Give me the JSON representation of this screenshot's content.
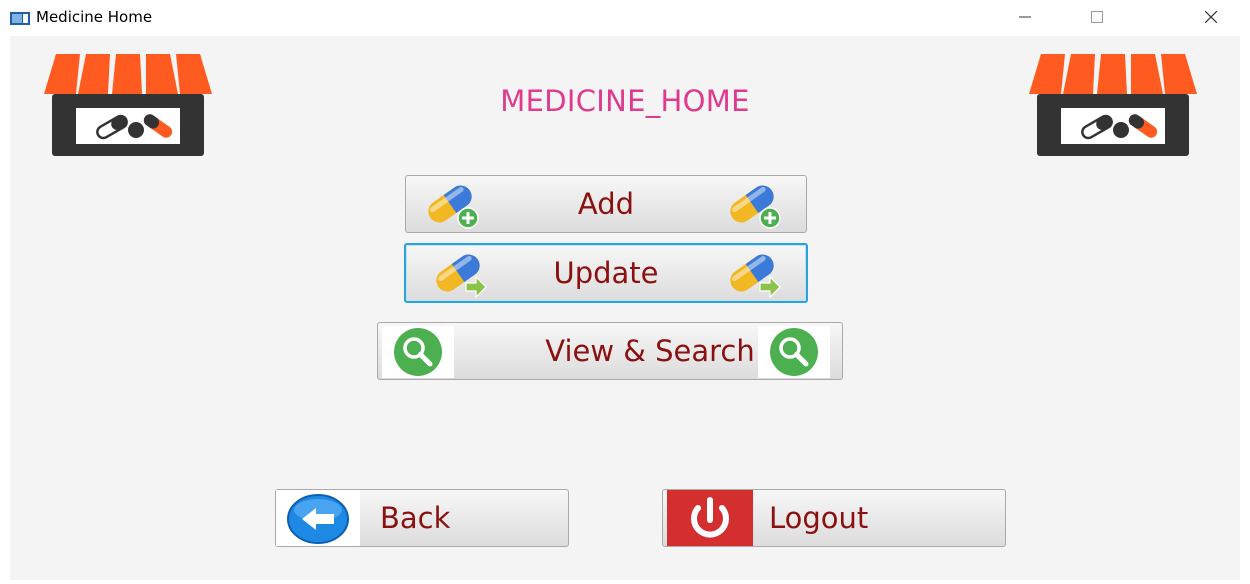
{
  "window": {
    "title": "Medicine Home",
    "minimize_icon": "minimize-icon",
    "maximize_icon": "maximize-icon",
    "close_icon": "close-icon"
  },
  "page": {
    "heading": "MEDICINE_HOME",
    "left_logo": "pharmacy-store-icon",
    "right_logo": "pharmacy-store-icon"
  },
  "buttons": {
    "add": {
      "label": "Add",
      "icon": "pill-add-icon"
    },
    "update": {
      "label": "Update",
      "icon": "pill-update-icon",
      "focused": true
    },
    "view_search": {
      "label": "View & Search",
      "icon": "search-icon"
    },
    "back": {
      "label": "Back",
      "icon": "back-arrow-icon"
    },
    "logout": {
      "label": "Logout",
      "icon": "power-icon"
    }
  },
  "colors": {
    "heading": "#e03a8e",
    "button_text": "#8b1010",
    "focus_border": "#2aa2dc",
    "awning": "#ff5a1f",
    "search_green": "#4caf50",
    "back_blue": "#1e88e5",
    "logout_red": "#d32f2f"
  }
}
